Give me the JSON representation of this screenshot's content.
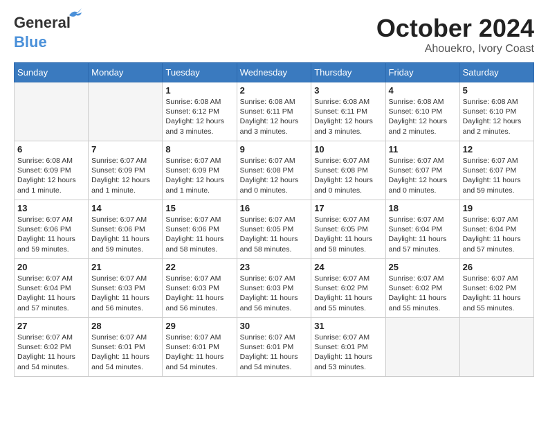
{
  "header": {
    "logo_line1": "General",
    "logo_line2": "Blue",
    "month": "October 2024",
    "location": "Ahouekro, Ivory Coast"
  },
  "weekdays": [
    "Sunday",
    "Monday",
    "Tuesday",
    "Wednesday",
    "Thursday",
    "Friday",
    "Saturday"
  ],
  "weeks": [
    [
      {
        "day": "",
        "info": ""
      },
      {
        "day": "",
        "info": ""
      },
      {
        "day": "1",
        "info": "Sunrise: 6:08 AM\nSunset: 6:12 PM\nDaylight: 12 hours\nand 3 minutes."
      },
      {
        "day": "2",
        "info": "Sunrise: 6:08 AM\nSunset: 6:11 PM\nDaylight: 12 hours\nand 3 minutes."
      },
      {
        "day": "3",
        "info": "Sunrise: 6:08 AM\nSunset: 6:11 PM\nDaylight: 12 hours\nand 3 minutes."
      },
      {
        "day": "4",
        "info": "Sunrise: 6:08 AM\nSunset: 6:10 PM\nDaylight: 12 hours\nand 2 minutes."
      },
      {
        "day": "5",
        "info": "Sunrise: 6:08 AM\nSunset: 6:10 PM\nDaylight: 12 hours\nand 2 minutes."
      }
    ],
    [
      {
        "day": "6",
        "info": "Sunrise: 6:08 AM\nSunset: 6:09 PM\nDaylight: 12 hours\nand 1 minute."
      },
      {
        "day": "7",
        "info": "Sunrise: 6:07 AM\nSunset: 6:09 PM\nDaylight: 12 hours\nand 1 minute."
      },
      {
        "day": "8",
        "info": "Sunrise: 6:07 AM\nSunset: 6:09 PM\nDaylight: 12 hours\nand 1 minute."
      },
      {
        "day": "9",
        "info": "Sunrise: 6:07 AM\nSunset: 6:08 PM\nDaylight: 12 hours\nand 0 minutes."
      },
      {
        "day": "10",
        "info": "Sunrise: 6:07 AM\nSunset: 6:08 PM\nDaylight: 12 hours\nand 0 minutes."
      },
      {
        "day": "11",
        "info": "Sunrise: 6:07 AM\nSunset: 6:07 PM\nDaylight: 12 hours\nand 0 minutes."
      },
      {
        "day": "12",
        "info": "Sunrise: 6:07 AM\nSunset: 6:07 PM\nDaylight: 11 hours\nand 59 minutes."
      }
    ],
    [
      {
        "day": "13",
        "info": "Sunrise: 6:07 AM\nSunset: 6:06 PM\nDaylight: 11 hours\nand 59 minutes."
      },
      {
        "day": "14",
        "info": "Sunrise: 6:07 AM\nSunset: 6:06 PM\nDaylight: 11 hours\nand 59 minutes."
      },
      {
        "day": "15",
        "info": "Sunrise: 6:07 AM\nSunset: 6:06 PM\nDaylight: 11 hours\nand 58 minutes."
      },
      {
        "day": "16",
        "info": "Sunrise: 6:07 AM\nSunset: 6:05 PM\nDaylight: 11 hours\nand 58 minutes."
      },
      {
        "day": "17",
        "info": "Sunrise: 6:07 AM\nSunset: 6:05 PM\nDaylight: 11 hours\nand 58 minutes."
      },
      {
        "day": "18",
        "info": "Sunrise: 6:07 AM\nSunset: 6:04 PM\nDaylight: 11 hours\nand 57 minutes."
      },
      {
        "day": "19",
        "info": "Sunrise: 6:07 AM\nSunset: 6:04 PM\nDaylight: 11 hours\nand 57 minutes."
      }
    ],
    [
      {
        "day": "20",
        "info": "Sunrise: 6:07 AM\nSunset: 6:04 PM\nDaylight: 11 hours\nand 57 minutes."
      },
      {
        "day": "21",
        "info": "Sunrise: 6:07 AM\nSunset: 6:03 PM\nDaylight: 11 hours\nand 56 minutes."
      },
      {
        "day": "22",
        "info": "Sunrise: 6:07 AM\nSunset: 6:03 PM\nDaylight: 11 hours\nand 56 minutes."
      },
      {
        "day": "23",
        "info": "Sunrise: 6:07 AM\nSunset: 6:03 PM\nDaylight: 11 hours\nand 56 minutes."
      },
      {
        "day": "24",
        "info": "Sunrise: 6:07 AM\nSunset: 6:02 PM\nDaylight: 11 hours\nand 55 minutes."
      },
      {
        "day": "25",
        "info": "Sunrise: 6:07 AM\nSunset: 6:02 PM\nDaylight: 11 hours\nand 55 minutes."
      },
      {
        "day": "26",
        "info": "Sunrise: 6:07 AM\nSunset: 6:02 PM\nDaylight: 11 hours\nand 55 minutes."
      }
    ],
    [
      {
        "day": "27",
        "info": "Sunrise: 6:07 AM\nSunset: 6:02 PM\nDaylight: 11 hours\nand 54 minutes."
      },
      {
        "day": "28",
        "info": "Sunrise: 6:07 AM\nSunset: 6:01 PM\nDaylight: 11 hours\nand 54 minutes."
      },
      {
        "day": "29",
        "info": "Sunrise: 6:07 AM\nSunset: 6:01 PM\nDaylight: 11 hours\nand 54 minutes."
      },
      {
        "day": "30",
        "info": "Sunrise: 6:07 AM\nSunset: 6:01 PM\nDaylight: 11 hours\nand 54 minutes."
      },
      {
        "day": "31",
        "info": "Sunrise: 6:07 AM\nSunset: 6:01 PM\nDaylight: 11 hours\nand 53 minutes."
      },
      {
        "day": "",
        "info": ""
      },
      {
        "day": "",
        "info": ""
      }
    ]
  ]
}
